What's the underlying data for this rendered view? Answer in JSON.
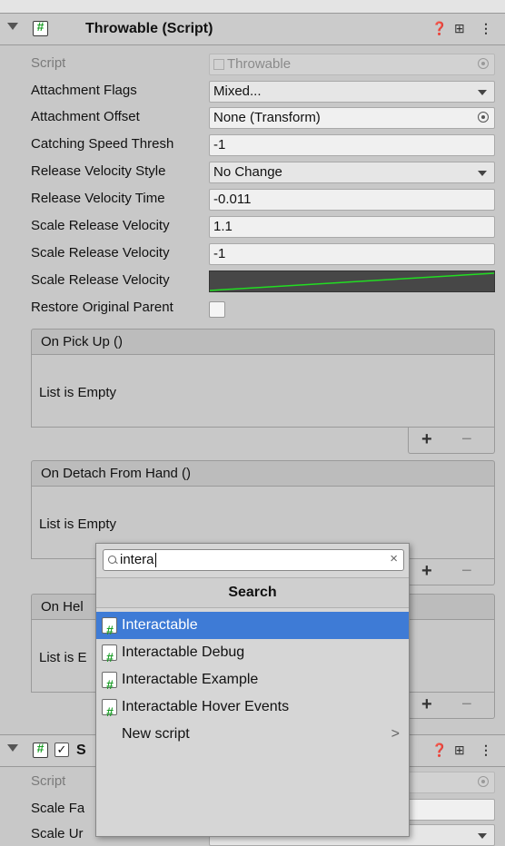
{
  "component": {
    "title": "Throwable (Script)",
    "icons": [
      "help-icon",
      "presets-icon",
      "kebab-menu-icon"
    ]
  },
  "rows": [
    {
      "label": "Script",
      "value": "Throwable",
      "type": "object-disabled"
    },
    {
      "label": "Attachment Flags",
      "value": "Mixed...",
      "type": "dropdown"
    },
    {
      "label": "Attachment Offset",
      "value": "None (Transform)",
      "type": "object"
    },
    {
      "label": "Catching Speed Thresh",
      "value": "-1",
      "type": "text"
    },
    {
      "label": "Release Velocity Style",
      "value": "No Change",
      "type": "dropdown"
    },
    {
      "label": "Release Velocity Time",
      "value": "-0.011",
      "type": "text"
    },
    {
      "label": "Scale Release Velocity",
      "value": "1.1",
      "type": "text"
    },
    {
      "label": "Scale Release Velocity",
      "value": "-1",
      "type": "text"
    },
    {
      "label": "Scale Release Velocity",
      "value": "",
      "type": "curve"
    },
    {
      "label": "Restore Original Parent",
      "value": "",
      "type": "checkbox"
    }
  ],
  "events": [
    {
      "title": "On Pick Up ()",
      "empty_text": "List is Empty",
      "plus": "+",
      "minus": "−"
    },
    {
      "title": "On Detach From Hand ()",
      "empty_text": "List is Empty",
      "plus": "+",
      "minus": "−"
    },
    {
      "title": "On Hel",
      "empty_text": "List is E",
      "plus": "+",
      "minus": "−"
    }
  ],
  "component2": {
    "title_partial": "S",
    "rows": [
      {
        "label": "Script"
      },
      {
        "label": "Scale Fa"
      },
      {
        "label": "Scale Ur"
      }
    ]
  },
  "popup": {
    "search_value": "intera",
    "clear": "×",
    "title": "Search",
    "items": [
      {
        "label": "Interactable",
        "selected": true
      },
      {
        "label": "Interactable Debug",
        "selected": false
      },
      {
        "label": "Interactable Example",
        "selected": false
      },
      {
        "label": "Interactable Hover Events",
        "selected": false
      }
    ],
    "new_script": "New script",
    "new_script_arrow": ">"
  },
  "colors": {
    "selection": "#3e7bd6",
    "script_hash": "#1a9e26",
    "curve_line": "#22dd22",
    "curve_bg": "#474747"
  }
}
